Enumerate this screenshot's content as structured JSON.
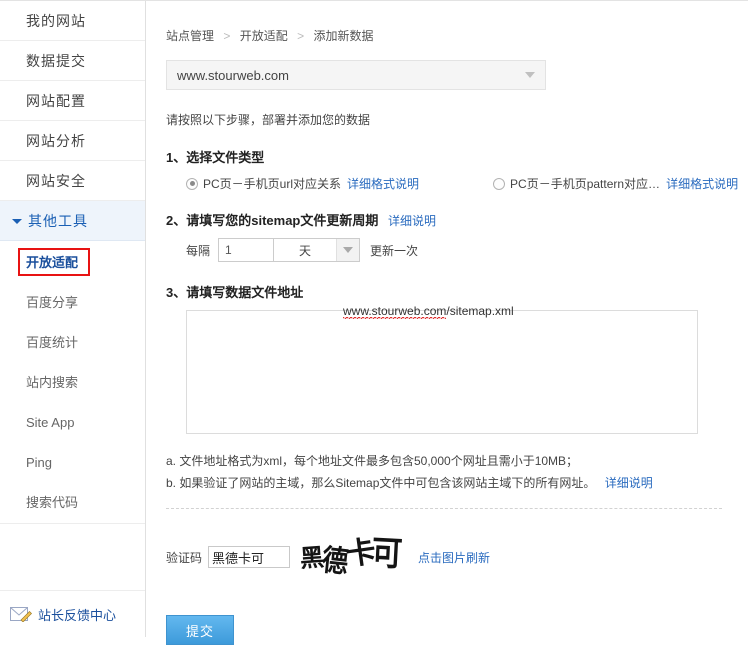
{
  "sidebar": {
    "items": [
      {
        "label": "我的网站"
      },
      {
        "label": "数据提交"
      },
      {
        "label": "网站配置"
      },
      {
        "label": "网站分析"
      },
      {
        "label": "网站安全"
      }
    ],
    "expanded_group": {
      "label": "其他工具",
      "icon": "triangle-down-icon"
    },
    "sub_items": [
      {
        "label": "开放适配",
        "active": true
      },
      {
        "label": "百度分享",
        "active": false
      },
      {
        "label": "百度统计",
        "active": false
      },
      {
        "label": "站内搜索",
        "active": false
      },
      {
        "label": "Site App",
        "active": false
      },
      {
        "label": "Ping",
        "active": false
      },
      {
        "label": "搜索代码",
        "active": false
      }
    ],
    "feedback": {
      "label": "站长反馈中心",
      "icon": "envelope-pencil-icon"
    },
    "highlight_color": "#e81313"
  },
  "main": {
    "breadcrumb": [
      "站点管理",
      "开放适配",
      "添加新数据"
    ],
    "breadcrumb_separator": ">",
    "site_select": {
      "value": "www.stourweb.com",
      "icon": "caret-down-icon"
    },
    "intro": "请按照以下步骤，部署并添加您的数据",
    "step1": {
      "title": "1、选择文件类型",
      "option_a": {
        "label": "PC页－手机页url对应关系",
        "link": "详细格式说明",
        "checked": true
      },
      "option_b": {
        "label": "PC页－手机页pattern对应…",
        "link": "详细格式说明",
        "checked": false
      }
    },
    "step2": {
      "title": "2、请填写您的sitemap文件更新周期",
      "link": "详细说明",
      "prefix": "每隔",
      "interval_value": "1",
      "unit_value": "天",
      "unit_icon": "caret-down-icon",
      "suffix": "更新一次"
    },
    "step3": {
      "title": "3、请填写数据文件地址",
      "textarea_value": "www.stourweb.com/sitemap.xml",
      "textarea_misspelled": "www.stourweb.com",
      "textarea_rest": "/sitemap.xml"
    },
    "notes": {
      "a": "a. 文件地址格式为xml，每个地址文件最多包含50,000个网址且需小于10MB；",
      "b": "b. 如果验证了网站的主域，那么Sitemap文件中可包含该网站主域下的所有网址。",
      "b_link": "详细说明"
    },
    "captcha": {
      "label": "验证码",
      "input_value": "黑德卡可",
      "image_chars": [
        "黑",
        "德",
        "卡",
        "可"
      ],
      "refresh_link": "点击图片刷新"
    },
    "submit": {
      "label": "提交",
      "color": "#4aa3e0"
    }
  }
}
